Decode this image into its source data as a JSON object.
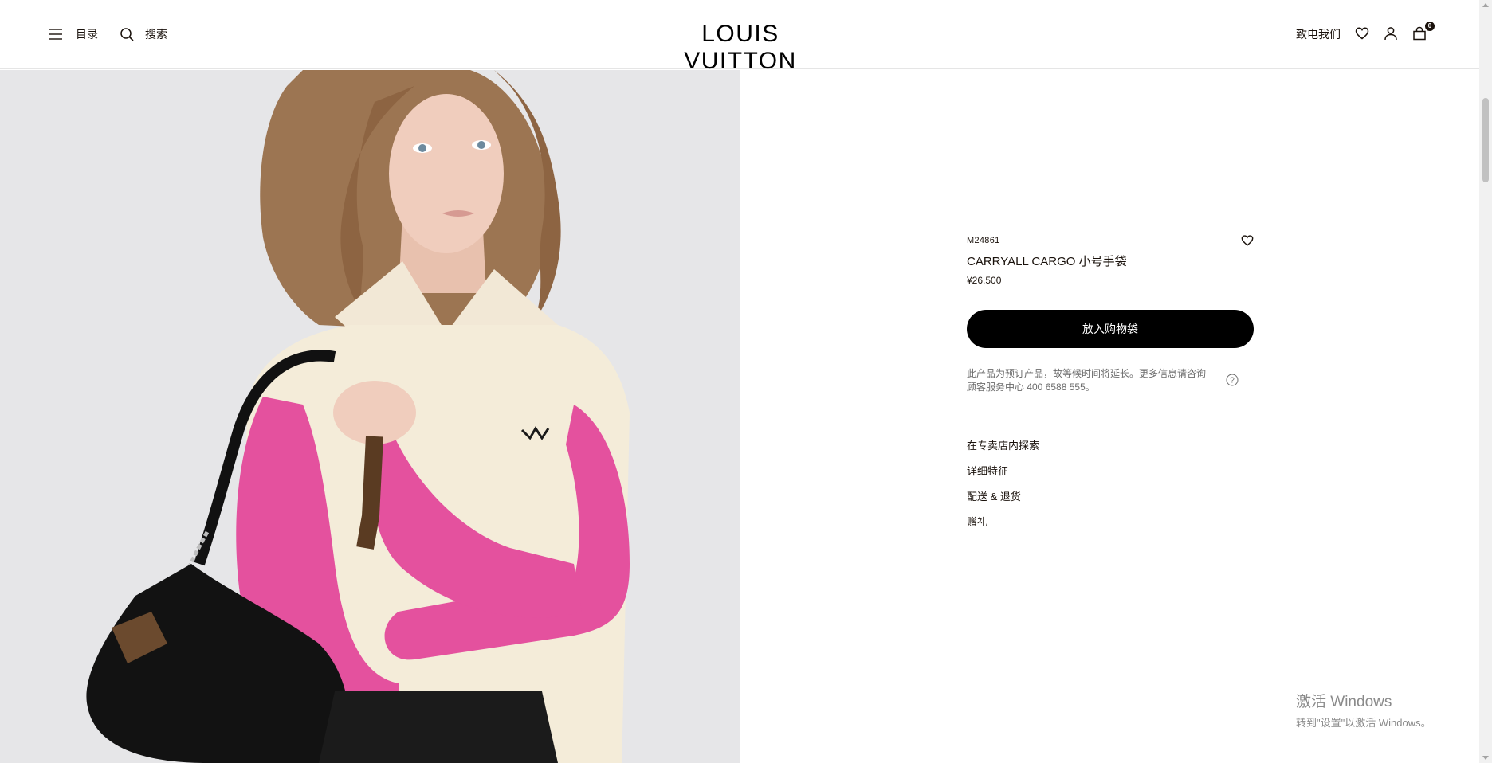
{
  "header": {
    "menu_label": "目录",
    "search_label": "搜索",
    "logo": "LOUIS VUITTON",
    "contact_label": "致电我们",
    "bag_count": "0",
    "icons": [
      "menu-icon",
      "search-icon",
      "heart-icon",
      "user-icon",
      "shopping-bag-icon"
    ]
  },
  "product": {
    "sku": "M24861",
    "name": "CARRYALL CARGO 小号手袋",
    "price": "¥26,500",
    "add_to_bag_label": "放入购物袋",
    "notice": "此产品为预订产品，故等候时间将延长。更多信息请咨询顾客服务中心 400 6588 555。",
    "links": [
      "在专卖店内探索",
      "详细特征",
      "配送 & 退货",
      "赠礼"
    ]
  },
  "watermark": {
    "title": "激活 Windows",
    "subtitle": "转到\"设置\"以激活 Windows。"
  },
  "colors": {
    "text": "#19110b",
    "button_bg": "#000000",
    "sleeve_pink": "#e4519e",
    "sweater_cream": "#f4ecd9"
  }
}
